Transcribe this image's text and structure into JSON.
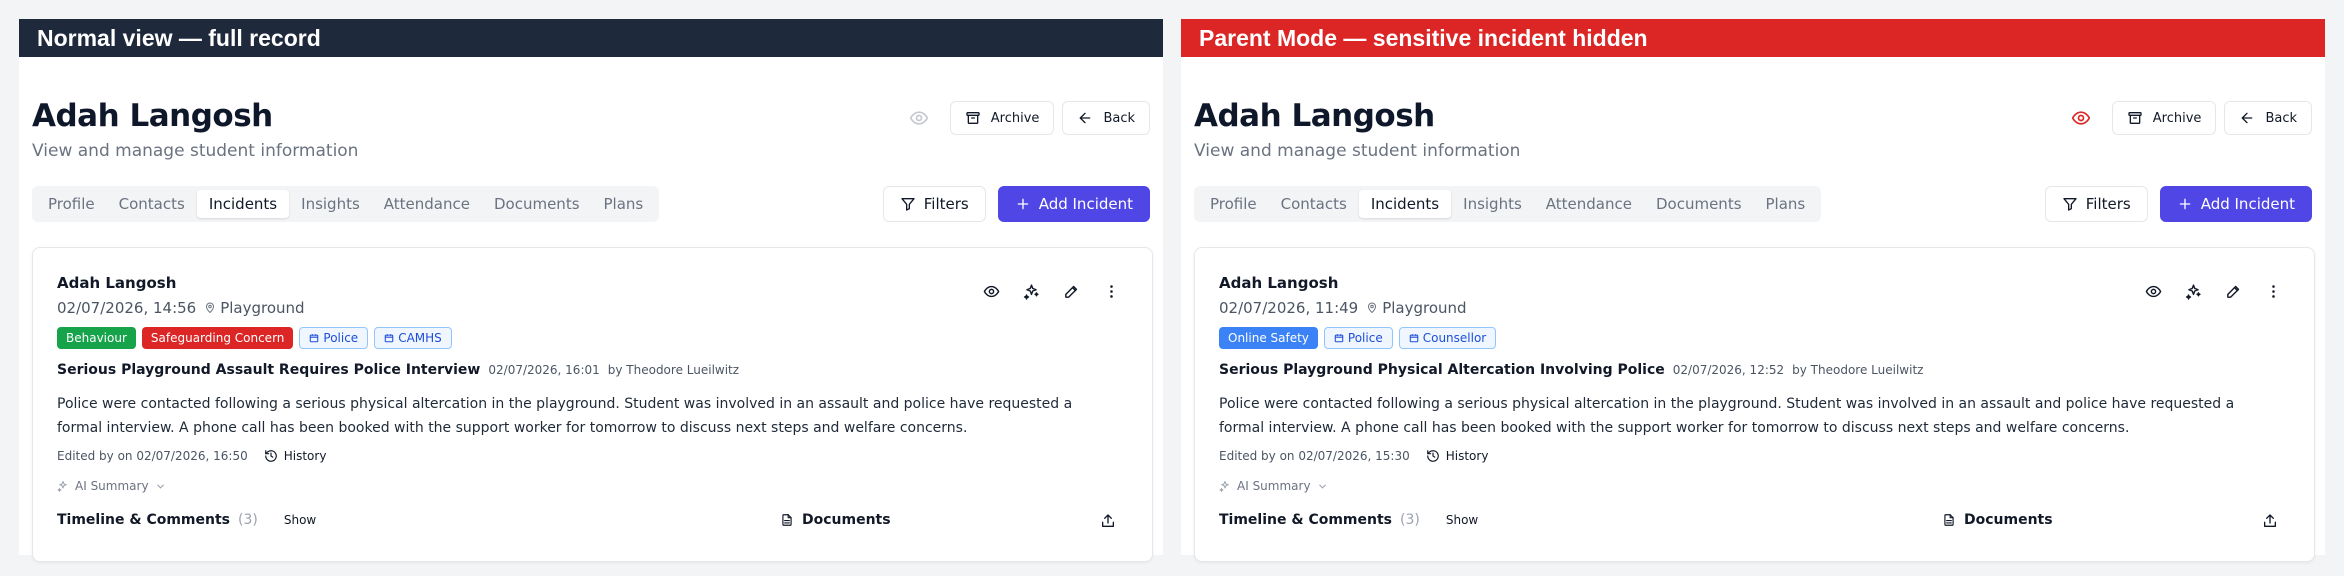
{
  "app": {
    "subtitle": "View and manage student information",
    "archive_label": "Archive",
    "back_label": "Back",
    "filters_label": "Filters",
    "add_incident_label": "Add Incident",
    "tabs": [
      "Profile",
      "Contacts",
      "Incidents",
      "Insights",
      "Attendance",
      "Documents",
      "Plans"
    ],
    "active_tab": "Incidents",
    "icons": [
      "eye-icon",
      "archive-icon",
      "arrow-left-icon",
      "filter-icon",
      "plus-icon",
      "sparkles-icon",
      "pencil-icon",
      "more-vertical-icon",
      "map-pin-icon",
      "calendar-icon",
      "history-icon",
      "chevron-down-icon",
      "file-text-icon",
      "upload-icon"
    ],
    "colors": {
      "accent": "#4f46e5",
      "banner_dark": "#1e293b",
      "banner_red": "#dc2626",
      "badge_green": "#16a34a",
      "badge_red": "#dc2626",
      "badge_blue": "#3b82f6",
      "eye_active": "#dc2626"
    }
  },
  "panels": [
    {
      "banner": "Normal view — full record",
      "student_name": "Adah Langosh",
      "incident": {
        "student": "Adah Langosh",
        "datetime": "02/07/2026, 14:56",
        "location": "Playground",
        "badges": [
          {
            "label": "Behaviour",
            "style": "green"
          },
          {
            "label": "Safeguarding Concern",
            "style": "red"
          },
          {
            "label": "Police",
            "style": "outline"
          },
          {
            "label": "CAMHS",
            "style": "outline"
          }
        ],
        "title": "Serious Playground Assault Requires Police Interview",
        "created": "02/07/2026, 16:01",
        "author": "by Theodore Lueilwitz",
        "body": "Police were contacted following a serious physical altercation in the playground. Student was involved in an assault and police have requested a formal interview. A phone call has been booked with the support worker for tomorrow to discuss next steps and welfare concerns.",
        "edited": "Edited by on 02/07/2026, 16:50",
        "history_label": "History",
        "ai_summary_label": "AI Summary",
        "timeline_label": "Timeline & Comments",
        "comment_count": "(3)",
        "show_label": "Show",
        "documents_label": "Documents"
      }
    },
    {
      "banner": "Parent Mode — sensitive incident hidden",
      "student_name": "Adah Langosh",
      "incident": {
        "student": "Adah Langosh",
        "datetime": "02/07/2026, 11:49",
        "location": "Playground",
        "badges": [
          {
            "label": "Online Safety",
            "style": "blue"
          },
          {
            "label": "Police",
            "style": "outline"
          },
          {
            "label": "Counsellor",
            "style": "outline"
          }
        ],
        "title": "Serious Playground Physical Altercation Involving Police",
        "created": "02/07/2026, 12:52",
        "author": "by Theodore Lueilwitz",
        "body": "Police were contacted following a serious physical altercation in the playground. Student was involved in an assault and police have requested a formal interview. A phone call has been booked with the support worker for tomorrow to discuss next steps and welfare concerns.",
        "edited": "Edited by on 02/07/2026, 15:30",
        "history_label": "History",
        "ai_summary_label": "AI Summary",
        "timeline_label": "Timeline & Comments",
        "comment_count": "(3)",
        "show_label": "Show",
        "documents_label": "Documents"
      }
    }
  ]
}
